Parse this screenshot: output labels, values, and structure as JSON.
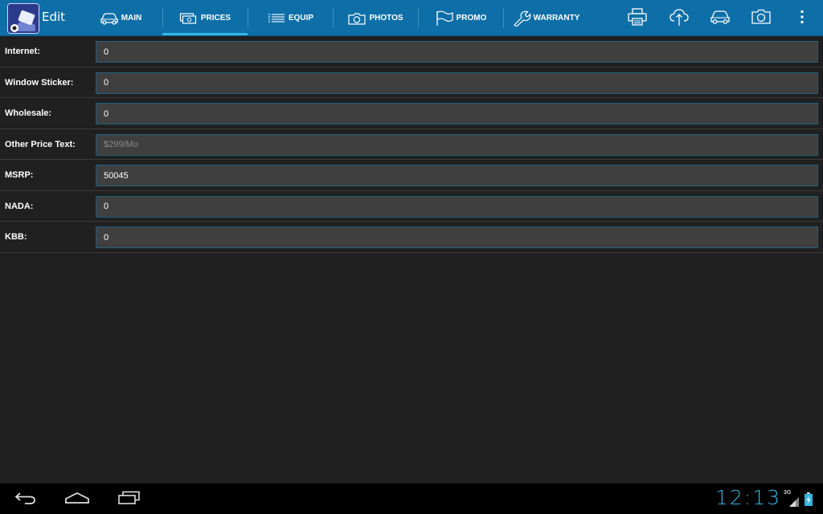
{
  "header": {
    "title": "Edit",
    "tabs": [
      {
        "id": "main",
        "label": "MAIN",
        "icon": "car-icon",
        "active": false
      },
      {
        "id": "prices",
        "label": "PRICES",
        "icon": "money-icon",
        "active": true
      },
      {
        "id": "equip",
        "label": "EQUIP",
        "icon": "list-icon",
        "active": false
      },
      {
        "id": "photos",
        "label": "PHOTOS",
        "icon": "camera-icon",
        "active": false
      },
      {
        "id": "promo",
        "label": "PROMO",
        "icon": "flag-icon",
        "active": false
      },
      {
        "id": "warranty",
        "label": "WARRANTY",
        "icon": "wrench-icon",
        "active": false
      }
    ],
    "actions": [
      "printer-icon",
      "cloud-upload-icon",
      "car-icon",
      "camera-icon",
      "overflow-menu-icon"
    ]
  },
  "form": {
    "fields": [
      {
        "label": "Internet:",
        "value": "0",
        "placeholder": ""
      },
      {
        "label": "Window Sticker:",
        "value": "0",
        "placeholder": ""
      },
      {
        "label": "Wholesale:",
        "value": "0",
        "placeholder": ""
      },
      {
        "label": "Other Price Text:",
        "value": "",
        "placeholder": "$299/Mo"
      },
      {
        "label": "MSRP:",
        "value": "50045",
        "placeholder": ""
      },
      {
        "label": "NADA:",
        "value": "0",
        "placeholder": ""
      },
      {
        "label": "KBB:",
        "value": "0",
        "placeholder": ""
      }
    ]
  },
  "status": {
    "time": "12:13",
    "network": "3G"
  },
  "colors": {
    "actionbar": "#0e6fa8",
    "accent": "#33b5e5",
    "background": "#202020"
  }
}
